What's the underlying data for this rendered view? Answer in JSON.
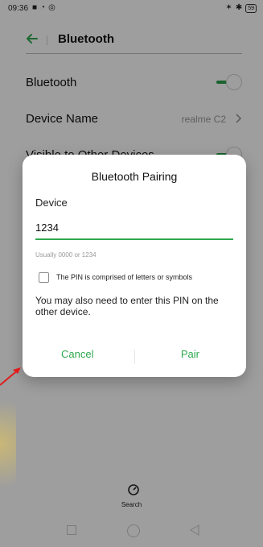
{
  "status_bar": {
    "time": "09:36",
    "battery": "59"
  },
  "header": {
    "title": "Bluetooth"
  },
  "settings": {
    "bluetooth_label": "Bluetooth",
    "device_name_label": "Device Name",
    "device_name_value": "realme C2",
    "visible_label": "Visible to Other Devices"
  },
  "dialog": {
    "title": "Bluetooth Pairing",
    "device_label": "Device",
    "pin_value": "1234",
    "hint": "Usually 0000 or 1234",
    "checkbox_label": "The PIN is comprised of letters or symbols",
    "note": "You may also need to enter this PIN on the other device.",
    "cancel_label": "Cancel",
    "pair_label": "Pair"
  },
  "bottom": {
    "search_label": "Search"
  },
  "colors": {
    "accent": "#2fa84f",
    "arrow": "#e11b1b"
  }
}
